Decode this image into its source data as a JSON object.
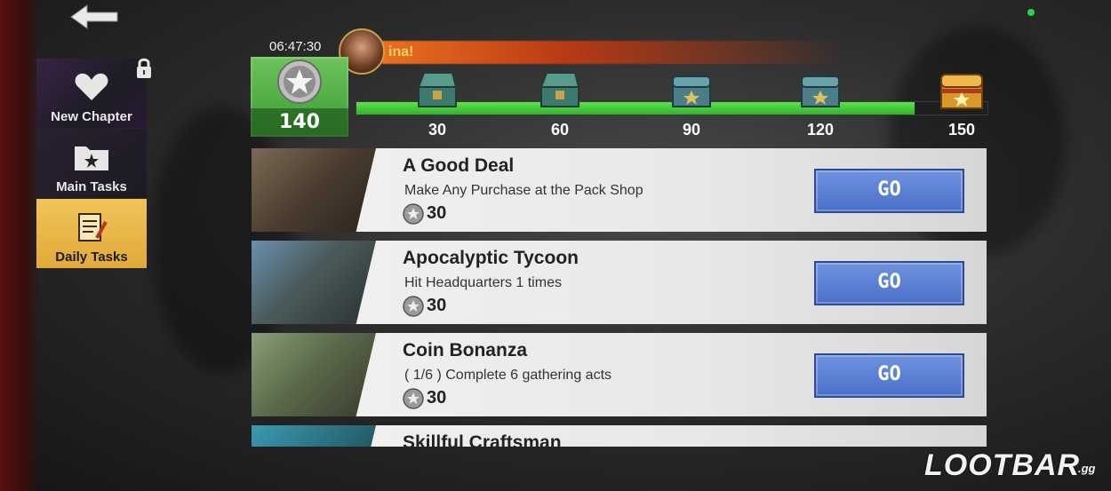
{
  "header": {
    "timer": "06:47:30",
    "banner_text": "ina!",
    "points": "140",
    "progress_fraction": 0.885,
    "milestones": [
      {
        "value": "30",
        "state": "opened",
        "color": "#3d7a6e"
      },
      {
        "value": "60",
        "state": "opened",
        "color": "#3d7a6e"
      },
      {
        "value": "90",
        "state": "closed",
        "color": "#4b7e86"
      },
      {
        "value": "120",
        "state": "closed",
        "color": "#4b7e86"
      },
      {
        "value": "150",
        "state": "closed",
        "color": "#d79a2a"
      }
    ]
  },
  "sidebar": {
    "items": [
      {
        "label": "New Chapter",
        "icon": "heart-icon",
        "locked": true
      },
      {
        "label": "Main Tasks",
        "icon": "folder-star-icon"
      },
      {
        "label": "Daily Tasks",
        "icon": "checklist-icon",
        "active": true
      }
    ]
  },
  "tasks": [
    {
      "title": "A Good Deal",
      "desc": "Make Any Purchase at the Pack Shop",
      "reward": "30",
      "button": "GO"
    },
    {
      "title": "Apocalyptic Tycoon",
      "desc": "Hit Headquarters 1 times",
      "reward": "30",
      "button": "GO"
    },
    {
      "title": "Coin Bonanza",
      "desc": "( 1/6 ) Complete 6 gathering acts",
      "reward": "30",
      "button": "GO"
    },
    {
      "title": "Skillful Craftsman",
      "desc": "",
      "reward": "",
      "button": ""
    }
  ],
  "watermark": {
    "logo": "LOOTBAR",
    "suffix": ".gg"
  },
  "colors": {
    "accent_green": "#3e9a35",
    "go_blue": "#4a6fc8",
    "active_tab": "#e2a93a"
  }
}
